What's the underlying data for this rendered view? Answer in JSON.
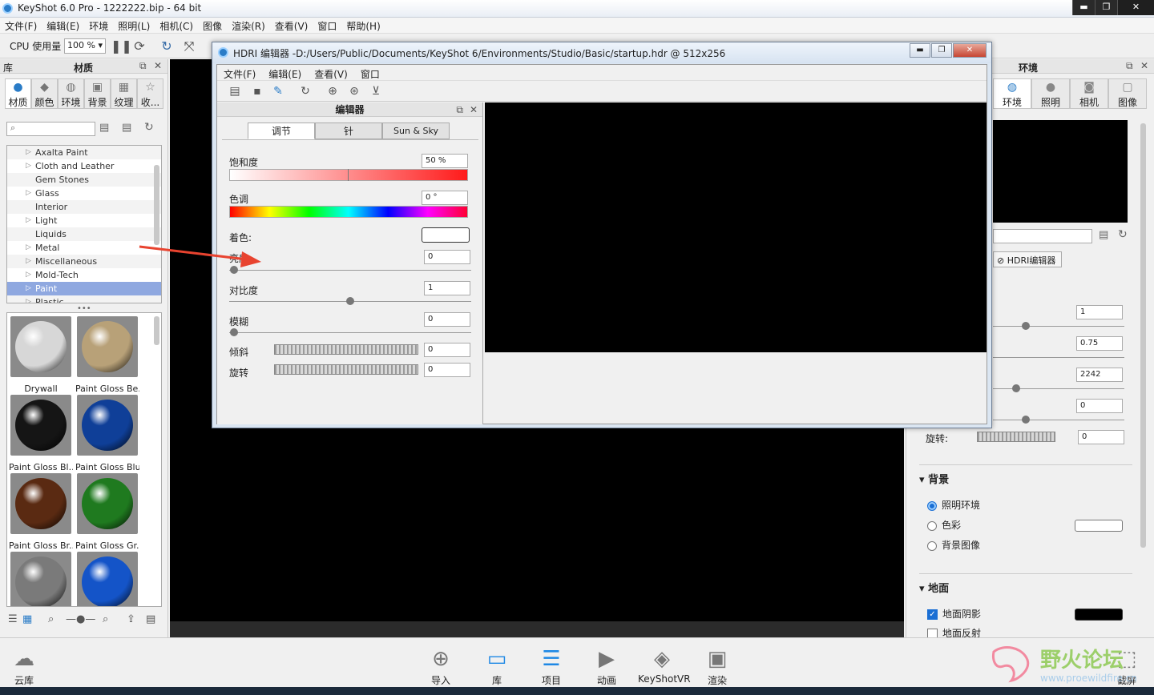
{
  "window": {
    "title": "KeyShot 6.0 Pro  - 1222222.bip  - 64 bit",
    "min": "▬",
    "max": "❐",
    "close": "✕"
  },
  "menu": [
    "文件(F)",
    "编辑(E)",
    "环境",
    "照明(L)",
    "相机(C)",
    "图像",
    "渲染(R)",
    "查看(V)",
    "窗口",
    "帮助(H)"
  ],
  "toolbar": {
    "cpu_label": "CPU 使用量",
    "cpu_value": "100 %"
  },
  "library": {
    "header_left": "库",
    "header_title": "材质",
    "tabs": [
      "材质",
      "颜色",
      "环境",
      "背景",
      "纹理",
      "收..."
    ],
    "search_placeholder": "",
    "tree": [
      "Axalta Paint",
      "Cloth and Leather",
      "Gem Stones",
      "Glass",
      "Interior",
      "Light",
      "Liquids",
      "Metal",
      "Miscellaneous",
      "Mold-Tech",
      "Paint",
      "Plastic"
    ],
    "selected_tree": "Paint",
    "thumbs": [
      {
        "label": "Drywall",
        "color": "#d7d7d7"
      },
      {
        "label": "Paint Gloss Be...",
        "color": "#b8a178"
      },
      {
        "label": "Paint Gloss Bl...",
        "color": "#151515"
      },
      {
        "label": "Paint Gloss Blue",
        "color": "#0f3f98"
      },
      {
        "label": "Paint Gloss Br...",
        "color": "#5a2a12"
      },
      {
        "label": "Paint Gloss Gr...",
        "color": "#1f7a1f"
      },
      {
        "label": "",
        "color": "#7a7a7a"
      },
      {
        "label": "",
        "color": "#1454c8"
      }
    ]
  },
  "environment": {
    "header_title": "环境",
    "tabs": [
      "环境",
      "照明",
      "相机",
      "图像"
    ],
    "hdri_button": "HDRI编辑器",
    "fields": [
      "1",
      "0.75",
      "2242",
      "0",
      "0"
    ],
    "rotation_label": "旋转:",
    "background_title": "背景",
    "bg_options": [
      "照明环境",
      "色彩",
      "背景图像"
    ],
    "ground_title": "地面",
    "ground_shadow": "地面阴影",
    "ground_reflection": "地面反射"
  },
  "bottombar": {
    "cloud": "云库",
    "items": [
      "导入",
      "库",
      "项目",
      "动画",
      "KeyShotVR",
      "渲染"
    ],
    "right": "截屏"
  },
  "dialog": {
    "title": "HDRI 编辑器 -D:/Users/Public/Documents/KeyShot 6/Environments/Studio/Basic/startup.hdr @ 512x256",
    "min": "▬",
    "max": "❐",
    "close": "✕",
    "menu": [
      "文件(F)",
      "编辑(E)",
      "查看(V)",
      "窗口"
    ],
    "panel_title": "编辑器",
    "tabs": [
      "调节",
      "针",
      "Sun & Sky"
    ],
    "saturation_label": "饱和度",
    "saturation_value": "50 %",
    "hue_label": "色调",
    "hue_value": "0 °",
    "tint_label": "着色:",
    "brightness_label": "亮度",
    "brightness_value": "0",
    "contrast_label": "对比度",
    "contrast_value": "1",
    "blur_label": "模糊",
    "blur_value": "0",
    "tilt_label": "倾斜",
    "tilt_value": "0",
    "rotate_label": "旋转",
    "rotate_value": "0"
  },
  "watermark": {
    "text": "野火论坛",
    "url": "www.proewildfire.cn"
  }
}
